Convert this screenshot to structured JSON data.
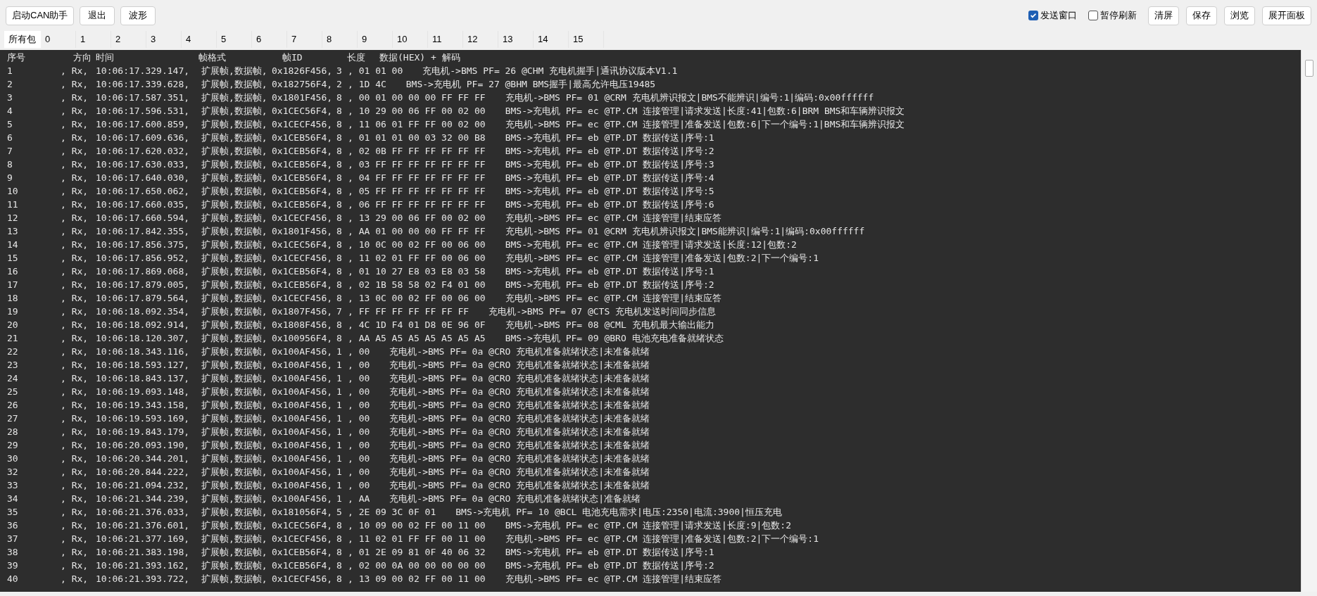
{
  "toolbar": {
    "buttons": [
      "启动CAN助手",
      "退出",
      "波形"
    ],
    "checkboxes": [
      {
        "label": "发送窗口",
        "checked": true
      },
      {
        "label": "暂停刷新",
        "checked": false
      }
    ],
    "right_buttons": [
      "清屏",
      "保存",
      "浏览",
      "展开面板"
    ]
  },
  "tabs": [
    {
      "label": "所有包",
      "selected": true
    },
    {
      "label": "0",
      "selected": false
    },
    {
      "label": "1",
      "selected": false
    },
    {
      "label": "2",
      "selected": false
    },
    {
      "label": "3",
      "selected": false
    },
    {
      "label": "4",
      "selected": false
    },
    {
      "label": "5",
      "selected": false
    },
    {
      "label": "6",
      "selected": false
    },
    {
      "label": "7",
      "selected": false
    },
    {
      "label": "8",
      "selected": false
    },
    {
      "label": "9",
      "selected": false
    },
    {
      "label": "10",
      "selected": false
    },
    {
      "label": "11",
      "selected": false
    },
    {
      "label": "12",
      "selected": false
    },
    {
      "label": "13",
      "selected": false
    },
    {
      "label": "14",
      "selected": false
    },
    {
      "label": "15",
      "selected": false
    }
  ],
  "log": {
    "columns": [
      "序号",
      "方向",
      "时间",
      "帧格式",
      "帧ID",
      "长度",
      "数据(HEX) + 解码"
    ],
    "rows": [
      {
        "seq": "1",
        "dir": ", Rx,",
        "time": "10:06:17.329.147,",
        "format": "扩展帧,数据帧,",
        "id": "0x1826F456,",
        "len": "3",
        "data": ", 01 01 00",
        "decode": "充电机->BMS PF= 26 @CHM 充电机握手|通讯协议版本V1.1"
      },
      {
        "seq": "2",
        "dir": ", Rx,",
        "time": "10:06:17.339.628,",
        "format": "扩展帧,数据帧,",
        "id": "0x182756F4,",
        "len": "2",
        "data": ", 1D 4C",
        "decode": "BMS->充电机 PF= 27 @BHM BMS握手|最高允许电压19485"
      },
      {
        "seq": "3",
        "dir": ", Rx,",
        "time": "10:06:17.587.351,",
        "format": "扩展帧,数据帧,",
        "id": "0x1801F456,",
        "len": "8",
        "data": ", 00 01 00 00 00 FF FF FF",
        "decode": "充电机->BMS PF= 01 @CRM 充电机辨识报文|BMS不能辨识|编号:1|编码:0x00ffffff"
      },
      {
        "seq": "4",
        "dir": ", Rx,",
        "time": "10:06:17.596.531,",
        "format": "扩展帧,数据帧,",
        "id": "0x1CEC56F4,",
        "len": "8",
        "data": ", 10 29 00 06 FF 00 02 00",
        "decode": "BMS->充电机 PF= ec @TP.CM 连接管理|请求发送|长度:41|包数:6|BRM BMS和车辆辨识报文"
      },
      {
        "seq": "5",
        "dir": ", Rx,",
        "time": "10:06:17.600.859,",
        "format": "扩展帧,数据帧,",
        "id": "0x1CECF456,",
        "len": "8",
        "data": ", 11 06 01 FF FF 00 02 00",
        "decode": "充电机->BMS PF= ec @TP.CM 连接管理|准备发送|包数:6|下一个编号:1|BMS和车辆辨识报文"
      },
      {
        "seq": "6",
        "dir": ", Rx,",
        "time": "10:06:17.609.636,",
        "format": "扩展帧,数据帧,",
        "id": "0x1CEB56F4,",
        "len": "8",
        "data": ", 01 01 01 00 03 32 00 B8",
        "decode": "BMS->充电机 PF= eb @TP.DT 数据传送|序号:1"
      },
      {
        "seq": "7",
        "dir": ", Rx,",
        "time": "10:06:17.620.032,",
        "format": "扩展帧,数据帧,",
        "id": "0x1CEB56F4,",
        "len": "8",
        "data": ", 02 0B FF FF FF FF FF FF",
        "decode": "BMS->充电机 PF= eb @TP.DT 数据传送|序号:2"
      },
      {
        "seq": "8",
        "dir": ", Rx,",
        "time": "10:06:17.630.033,",
        "format": "扩展帧,数据帧,",
        "id": "0x1CEB56F4,",
        "len": "8",
        "data": ", 03 FF FF FF FF FF FF FF",
        "decode": "BMS->充电机 PF= eb @TP.DT 数据传送|序号:3"
      },
      {
        "seq": "9",
        "dir": ", Rx,",
        "time": "10:06:17.640.030,",
        "format": "扩展帧,数据帧,",
        "id": "0x1CEB56F4,",
        "len": "8",
        "data": ", 04 FF FF FF FF FF FF FF",
        "decode": "BMS->充电机 PF= eb @TP.DT 数据传送|序号:4"
      },
      {
        "seq": "10",
        "dir": ", Rx,",
        "time": "10:06:17.650.062,",
        "format": "扩展帧,数据帧,",
        "id": "0x1CEB56F4,",
        "len": "8",
        "data": ", 05 FF FF FF FF FF FF FF",
        "decode": "BMS->充电机 PF= eb @TP.DT 数据传送|序号:5"
      },
      {
        "seq": "11",
        "dir": ", Rx,",
        "time": "10:06:17.660.035,",
        "format": "扩展帧,数据帧,",
        "id": "0x1CEB56F4,",
        "len": "8",
        "data": ", 06 FF FF FF FF FF FF FF",
        "decode": "BMS->充电机 PF= eb @TP.DT 数据传送|序号:6"
      },
      {
        "seq": "12",
        "dir": ", Rx,",
        "time": "10:06:17.660.594,",
        "format": "扩展帧,数据帧,",
        "id": "0x1CECF456,",
        "len": "8",
        "data": ", 13 29 00 06 FF 00 02 00",
        "decode": "充电机->BMS PF= ec @TP.CM 连接管理|结束应答"
      },
      {
        "seq": "13",
        "dir": ", Rx,",
        "time": "10:06:17.842.355,",
        "format": "扩展帧,数据帧,",
        "id": "0x1801F456,",
        "len": "8",
        "data": ", AA 01 00 00 00 FF FF FF",
        "decode": "充电机->BMS PF= 01 @CRM 充电机辨识报文|BMS能辨识|编号:1|编码:0x00ffffff"
      },
      {
        "seq": "14",
        "dir": ", Rx,",
        "time": "10:06:17.856.375,",
        "format": "扩展帧,数据帧,",
        "id": "0x1CEC56F4,",
        "len": "8",
        "data": ", 10 0C 00 02 FF 00 06 00",
        "decode": "BMS->充电机 PF= ec @TP.CM 连接管理|请求发送|长度:12|包数:2"
      },
      {
        "seq": "15",
        "dir": ", Rx,",
        "time": "10:06:17.856.952,",
        "format": "扩展帧,数据帧,",
        "id": "0x1CECF456,",
        "len": "8",
        "data": ", 11 02 01 FF FF 00 06 00",
        "decode": "充电机->BMS PF= ec @TP.CM 连接管理|准备发送|包数:2|下一个编号:1"
      },
      {
        "seq": "16",
        "dir": ", Rx,",
        "time": "10:06:17.869.068,",
        "format": "扩展帧,数据帧,",
        "id": "0x1CEB56F4,",
        "len": "8",
        "data": ", 01 10 27 E8 03 E8 03 58",
        "decode": "BMS->充电机 PF= eb @TP.DT 数据传送|序号:1"
      },
      {
        "seq": "17",
        "dir": ", Rx,",
        "time": "10:06:17.879.005,",
        "format": "扩展帧,数据帧,",
        "id": "0x1CEB56F4,",
        "len": "8",
        "data": ", 02 1B 58 58 02 F4 01 00",
        "decode": "BMS->充电机 PF= eb @TP.DT 数据传送|序号:2"
      },
      {
        "seq": "18",
        "dir": ", Rx,",
        "time": "10:06:17.879.564,",
        "format": "扩展帧,数据帧,",
        "id": "0x1CECF456,",
        "len": "8",
        "data": ", 13 0C 00 02 FF 00 06 00",
        "decode": "充电机->BMS PF= ec @TP.CM 连接管理|结束应答"
      },
      {
        "seq": "19",
        "dir": ", Rx,",
        "time": "10:06:18.092.354,",
        "format": "扩展帧,数据帧,",
        "id": "0x1807F456,",
        "len": "7",
        "data": ", FF FF FF FF FF FF FF",
        "decode": "充电机->BMS PF= 07 @CTS 充电机发送时间同步信息"
      },
      {
        "seq": "20",
        "dir": ", Rx,",
        "time": "10:06:18.092.914,",
        "format": "扩展帧,数据帧,",
        "id": "0x1808F456,",
        "len": "8",
        "data": ", 4C 1D F4 01 D8 0E 96 0F",
        "decode": "充电机->BMS PF= 08 @CML 充电机最大输出能力"
      },
      {
        "seq": "21",
        "dir": ", Rx,",
        "time": "10:06:18.120.307,",
        "format": "扩展帧,数据帧,",
        "id": "0x100956F4,",
        "len": "8",
        "data": ", AA A5 A5 A5 A5 A5 A5 A5",
        "decode": "BMS->充电机 PF= 09 @BRO 电池充电准备就绪状态"
      },
      {
        "seq": "22",
        "dir": ", Rx,",
        "time": "10:06:18.343.116,",
        "format": "扩展帧,数据帧,",
        "id": "0x100AF456,",
        "len": "1",
        "data": ", 00",
        "decode": "充电机->BMS PF= 0a @CRO 充电机准备就绪状态|未准备就绪"
      },
      {
        "seq": "23",
        "dir": ", Rx,",
        "time": "10:06:18.593.127,",
        "format": "扩展帧,数据帧,",
        "id": "0x100AF456,",
        "len": "1",
        "data": ", 00",
        "decode": "充电机->BMS PF= 0a @CRO 充电机准备就绪状态|未准备就绪"
      },
      {
        "seq": "24",
        "dir": ", Rx,",
        "time": "10:06:18.843.137,",
        "format": "扩展帧,数据帧,",
        "id": "0x100AF456,",
        "len": "1",
        "data": ", 00",
        "decode": "充电机->BMS PF= 0a @CRO 充电机准备就绪状态|未准备就绪"
      },
      {
        "seq": "25",
        "dir": ", Rx,",
        "time": "10:06:19.093.148,",
        "format": "扩展帧,数据帧,",
        "id": "0x100AF456,",
        "len": "1",
        "data": ", 00",
        "decode": "充电机->BMS PF= 0a @CRO 充电机准备就绪状态|未准备就绪"
      },
      {
        "seq": "26",
        "dir": ", Rx,",
        "time": "10:06:19.343.158,",
        "format": "扩展帧,数据帧,",
        "id": "0x100AF456,",
        "len": "1",
        "data": ", 00",
        "decode": "充电机->BMS PF= 0a @CRO 充电机准备就绪状态|未准备就绪"
      },
      {
        "seq": "27",
        "dir": ", Rx,",
        "time": "10:06:19.593.169,",
        "format": "扩展帧,数据帧,",
        "id": "0x100AF456,",
        "len": "1",
        "data": ", 00",
        "decode": "充电机->BMS PF= 0a @CRO 充电机准备就绪状态|未准备就绪"
      },
      {
        "seq": "28",
        "dir": ", Rx,",
        "time": "10:06:19.843.179,",
        "format": "扩展帧,数据帧,",
        "id": "0x100AF456,",
        "len": "1",
        "data": ", 00",
        "decode": "充电机->BMS PF= 0a @CRO 充电机准备就绪状态|未准备就绪"
      },
      {
        "seq": "29",
        "dir": ", Rx,",
        "time": "10:06:20.093.190,",
        "format": "扩展帧,数据帧,",
        "id": "0x100AF456,",
        "len": "1",
        "data": ", 00",
        "decode": "充电机->BMS PF= 0a @CRO 充电机准备就绪状态|未准备就绪"
      },
      {
        "seq": "30",
        "dir": ", Rx,",
        "time": "10:06:20.344.201,",
        "format": "扩展帧,数据帧,",
        "id": "0x100AF456,",
        "len": "1",
        "data": ", 00",
        "decode": "充电机->BMS PF= 0a @CRO 充电机准备就绪状态|未准备就绪"
      },
      {
        "seq": "32",
        "dir": ", Rx,",
        "time": "10:06:20.844.222,",
        "format": "扩展帧,数据帧,",
        "id": "0x100AF456,",
        "len": "1",
        "data": ", 00",
        "decode": "充电机->BMS PF= 0a @CRO 充电机准备就绪状态|未准备就绪"
      },
      {
        "seq": "33",
        "dir": ", Rx,",
        "time": "10:06:21.094.232,",
        "format": "扩展帧,数据帧,",
        "id": "0x100AF456,",
        "len": "1",
        "data": ", 00",
        "decode": "充电机->BMS PF= 0a @CRO 充电机准备就绪状态|未准备就绪"
      },
      {
        "seq": "34",
        "dir": ", Rx,",
        "time": "10:06:21.344.239,",
        "format": "扩展帧,数据帧,",
        "id": "0x100AF456,",
        "len": "1",
        "data": ", AA",
        "decode": "充电机->BMS PF= 0a @CRO 充电机准备就绪状态|准备就绪"
      },
      {
        "seq": "35",
        "dir": ", Rx,",
        "time": "10:06:21.376.033,",
        "format": "扩展帧,数据帧,",
        "id": "0x181056F4,",
        "len": "5",
        "data": ", 2E 09 3C 0F 01",
        "decode": "BMS->充电机 PF= 10 @BCL 电池充电需求|电压:2350|电流:3900|恒压充电"
      },
      {
        "seq": "36",
        "dir": ", Rx,",
        "time": "10:06:21.376.601,",
        "format": "扩展帧,数据帧,",
        "id": "0x1CEC56F4,",
        "len": "8",
        "data": ", 10 09 00 02 FF 00 11 00",
        "decode": "BMS->充电机 PF= ec @TP.CM 连接管理|请求发送|长度:9|包数:2"
      },
      {
        "seq": "37",
        "dir": ", Rx,",
        "time": "10:06:21.377.169,",
        "format": "扩展帧,数据帧,",
        "id": "0x1CECF456,",
        "len": "8",
        "data": ", 11 02 01 FF FF 00 11 00",
        "decode": "充电机->BMS PF= ec @TP.CM 连接管理|准备发送|包数:2|下一个编号:1"
      },
      {
        "seq": "38",
        "dir": ", Rx,",
        "time": "10:06:21.383.198,",
        "format": "扩展帧,数据帧,",
        "id": "0x1CEB56F4,",
        "len": "8",
        "data": ", 01 2E 09 81 0F 40 06 32",
        "decode": "BMS->充电机 PF= eb @TP.DT 数据传送|序号:1"
      },
      {
        "seq": "39",
        "dir": ", Rx,",
        "time": "10:06:21.393.162,",
        "format": "扩展帧,数据帧,",
        "id": "0x1CEB56F4,",
        "len": "8",
        "data": ", 02 00 0A 00 00 00 00 00",
        "decode": "BMS->充电机 PF= eb @TP.DT 数据传送|序号:2"
      },
      {
        "seq": "40",
        "dir": ", Rx,",
        "time": "10:06:21.393.722,",
        "format": "扩展帧,数据帧,",
        "id": "0x1CECF456,",
        "len": "8",
        "data": ", 13 09 00 02 FF 00 11 00",
        "decode": "充电机->BMS PF= ec @TP.CM 连接管理|结束应答"
      }
    ]
  }
}
